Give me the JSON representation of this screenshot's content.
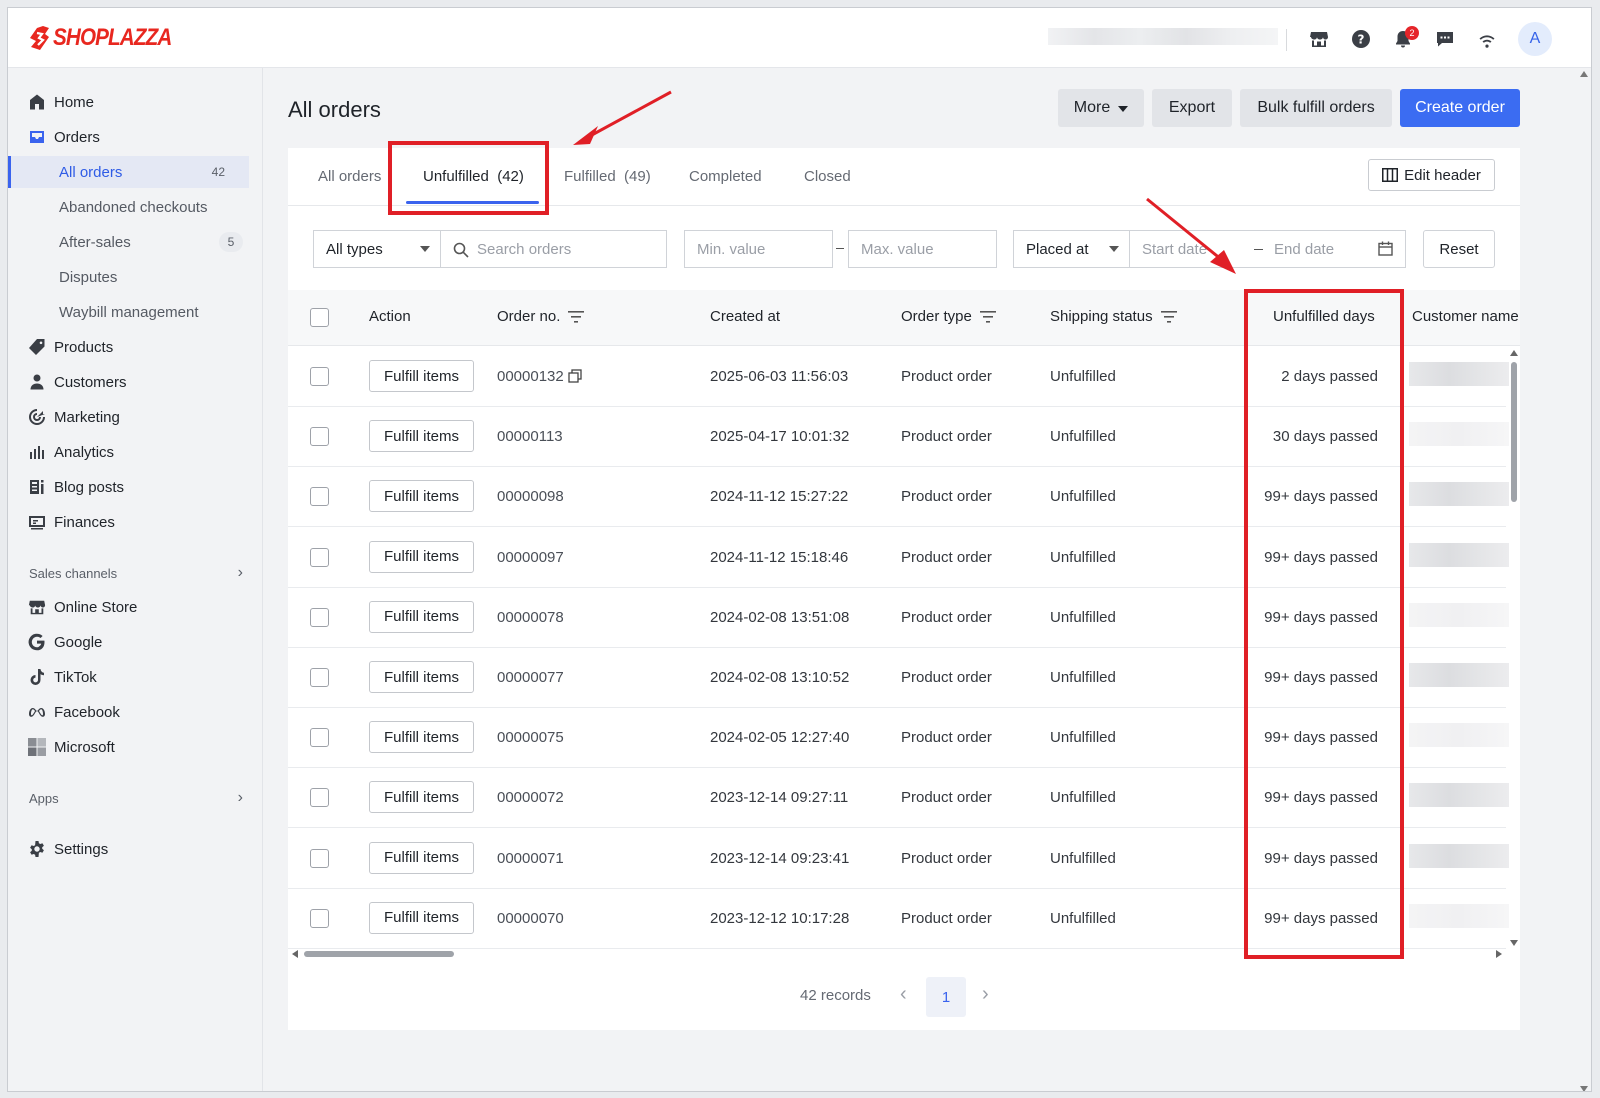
{
  "brand": {
    "name": "SHOPLAZZA",
    "color": "#e8271f"
  },
  "topbar": {
    "icons": [
      "store-icon",
      "help-icon",
      "bell-icon",
      "chat-icon",
      "wifi-icon"
    ],
    "notification_count": "2",
    "avatar_letter": "A"
  },
  "sidebar": {
    "home": "Home",
    "orders": "Orders",
    "all_orders": "All orders",
    "all_orders_count": "42",
    "abandoned": "Abandoned checkouts",
    "after_sales": "After-sales",
    "after_sales_count": "5",
    "disputes": "Disputes",
    "waybill": "Waybill management",
    "products": "Products",
    "customers": "Customers",
    "marketing": "Marketing",
    "analytics": "Analytics",
    "blog": "Blog posts",
    "finances": "Finances",
    "sales_channels": "Sales channels",
    "online_store": "Online Store",
    "google": "Google",
    "tiktok": "TikTok",
    "facebook": "Facebook",
    "microsoft": "Microsoft",
    "apps": "Apps",
    "settings": "Settings"
  },
  "header": {
    "title": "All orders",
    "more": "More",
    "export": "Export",
    "bulk_fulfill": "Bulk fulfill orders",
    "create_order": "Create order"
  },
  "tabs": {
    "all": "All orders",
    "unfulfilled": "Unfulfilled  (42)",
    "fulfilled": "Fulfilled  (49)",
    "completed": "Completed",
    "closed": "Closed",
    "edit_header": "Edit header"
  },
  "filters": {
    "type": "All types",
    "search_placeholder": "Search orders",
    "min_placeholder": "Min. value",
    "max_placeholder": "Max. value",
    "date_field": "Placed at",
    "start_placeholder": "Start date",
    "end_placeholder": "End date",
    "reset": "Reset"
  },
  "table": {
    "columns": {
      "action": "Action",
      "order_no": "Order no.",
      "created_at": "Created at",
      "order_type": "Order type",
      "shipping_status": "Shipping status",
      "unfulfilled_days": "Unfulfilled days",
      "customer_name": "Customer name"
    },
    "action_label": "Fulfill items",
    "rows": [
      {
        "order_no": "00000132",
        "created": "2025-06-03 11:56:03",
        "type": "Product order",
        "status": "Unfulfilled",
        "days": "2 days passed"
      },
      {
        "order_no": "00000113",
        "created": "2025-04-17 10:01:32",
        "type": "Product order",
        "status": "Unfulfilled",
        "days": "30 days passed"
      },
      {
        "order_no": "00000098",
        "created": "2024-11-12 15:27:22",
        "type": "Product order",
        "status": "Unfulfilled",
        "days": "99+ days passed"
      },
      {
        "order_no": "00000097",
        "created": "2024-11-12 15:18:46",
        "type": "Product order",
        "status": "Unfulfilled",
        "days": "99+ days passed"
      },
      {
        "order_no": "00000078",
        "created": "2024-02-08 13:51:08",
        "type": "Product order",
        "status": "Unfulfilled",
        "days": "99+ days passed"
      },
      {
        "order_no": "00000077",
        "created": "2024-02-08 13:10:52",
        "type": "Product order",
        "status": "Unfulfilled",
        "days": "99+ days passed"
      },
      {
        "order_no": "00000075",
        "created": "2024-02-05 12:27:40",
        "type": "Product order",
        "status": "Unfulfilled",
        "days": "99+ days passed"
      },
      {
        "order_no": "00000072",
        "created": "2023-12-14 09:27:11",
        "type": "Product order",
        "status": "Unfulfilled",
        "days": "99+ days passed"
      },
      {
        "order_no": "00000071",
        "created": "2023-12-14 09:23:41",
        "type": "Product order",
        "status": "Unfulfilled",
        "days": "99+ days passed"
      },
      {
        "order_no": "00000070",
        "created": "2023-12-12 10:17:28",
        "type": "Product order",
        "status": "Unfulfilled",
        "days": "99+ days passed"
      }
    ]
  },
  "pagination": {
    "records": "42 records",
    "current_page": "1"
  },
  "colors": {
    "primary": "#3b6cf2",
    "annotation": "#e01f26",
    "active_nav": "#2f5ce6"
  }
}
